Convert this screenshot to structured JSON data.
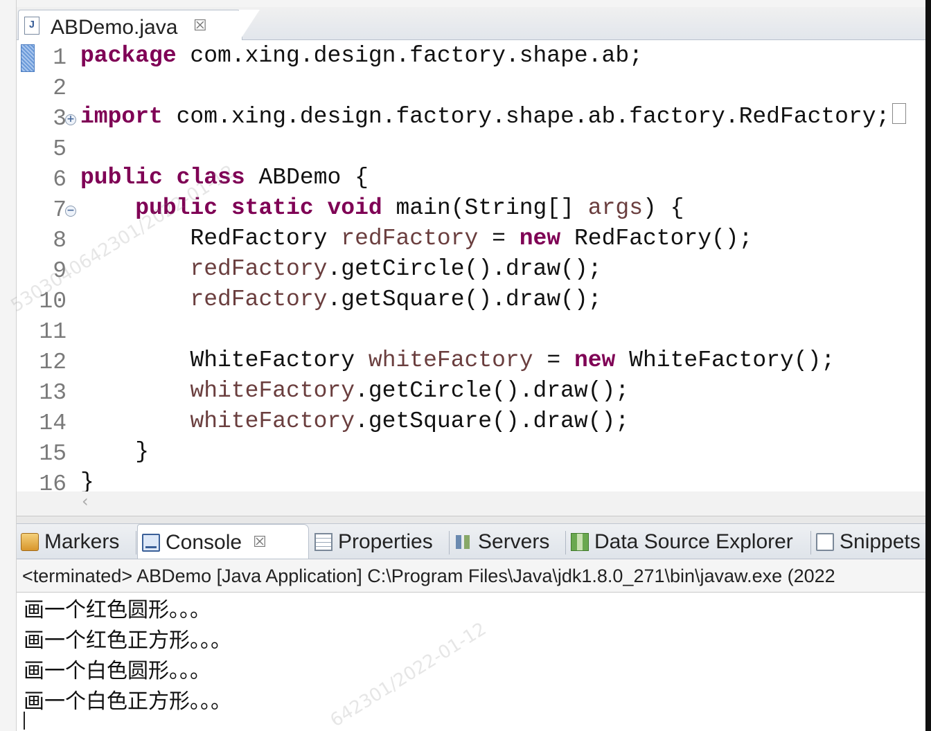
{
  "editor": {
    "tab_label": "ABDemo.java",
    "line_numbers": [
      "1",
      "2",
      "3",
      "5",
      "6",
      "7",
      "8",
      "9",
      "10",
      "11",
      "12",
      "13",
      "14",
      "15",
      "16"
    ],
    "lines": [
      {
        "kw": "package",
        "rest": " com.xing.design.factory.shape.ab;"
      },
      {
        "kw": "import",
        "rest": " com.xing.design.factory.shape.ab.factory.RedFactory;"
      },
      {
        "kw1": "public",
        "kw2": "class",
        "rest": " ABDemo {"
      },
      {
        "indent": "    ",
        "kw1": "public",
        "kw2": "static",
        "kw3": "void",
        "rest1": " main(String[] ",
        "var": "args",
        "rest2": ") {"
      },
      {
        "indent": "        ",
        "type": "RedFactory ",
        "var": "redFactory",
        "mid": " = ",
        "kw": "new",
        "rest": " RedFactory();"
      },
      {
        "indent": "        ",
        "var": "redFactory",
        "rest": ".getCircle().draw();"
      },
      {
        "indent": "        ",
        "var": "redFactory",
        "rest": ".getSquare().draw();"
      },
      {
        "indent": "        ",
        "type": "WhiteFactory ",
        "var": "whiteFactory",
        "mid": " = ",
        "kw": "new",
        "rest": " WhiteFactory();"
      },
      {
        "indent": "        ",
        "var": "whiteFactory",
        "rest": ".getCircle().draw();"
      },
      {
        "indent": "        ",
        "var": "whiteFactory",
        "rest": ".getSquare().draw();"
      },
      {
        "text": "    }"
      },
      {
        "text": "}"
      }
    ]
  },
  "panel": {
    "tabs": [
      {
        "label": "Markers"
      },
      {
        "label": "Console"
      },
      {
        "label": "Properties"
      },
      {
        "label": "Servers"
      },
      {
        "label": "Data Source Explorer"
      },
      {
        "label": "Snippets"
      }
    ]
  },
  "console": {
    "header": "<terminated> ABDemo [Java Application] C:\\Program Files\\Java\\jdk1.8.0_271\\bin\\javaw.exe (2022",
    "output": [
      "画一个红色圆形。。。",
      "画一个红色正方形。。。",
      "画一个白色圆形。。。",
      "画一个白色正方形。。。"
    ]
  },
  "watermark": {
    "text1": "5303040642301/2022-01-12",
    "text2": "642301/2022-01-12"
  }
}
